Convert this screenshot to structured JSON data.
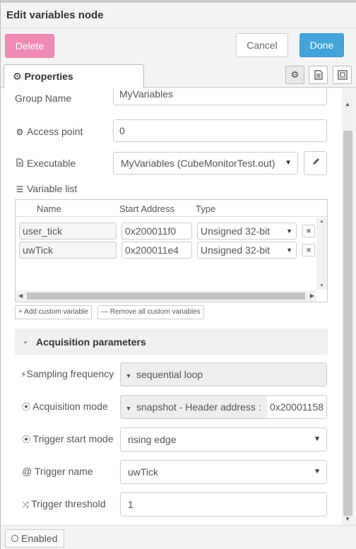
{
  "header": {
    "title": "Edit variables node"
  },
  "toolbar": {
    "delete_label": "Delete",
    "cancel_label": "Cancel",
    "done_label": "Done"
  },
  "tabs": {
    "properties_label": "Properties"
  },
  "form": {
    "group_name_label": "Group Name",
    "group_name_value": "MyVariables",
    "access_point_label": "Access point",
    "access_point_value": "0",
    "executable_label": "Executable",
    "executable_value": "MyVariables (CubeMonitorTest.out)",
    "variable_list_label": "Variable list"
  },
  "variables": {
    "columns": {
      "name": "Name",
      "start_address": "Start Address",
      "type": "Type"
    },
    "rows": [
      {
        "name": "user_tick",
        "address": "0x200011f0",
        "type": "Unsigned 32-bit"
      },
      {
        "name": "uwTick",
        "address": "0x200011e4",
        "type": "Unsigned 32-bit"
      }
    ],
    "add_custom_label": "+ Add custom variable",
    "remove_all_label": "— Remove all custom variables"
  },
  "acquisition": {
    "section_label": "Acquisition parameters",
    "sampling_label": "Sampling frequency",
    "sampling_value": "sequential loop",
    "mode_label": "Acquisition mode",
    "mode_value": "snapshot - Header address :",
    "mode_address": "0x20001158",
    "trigger_start_label": "Trigger start mode",
    "trigger_start_value": "rising edge",
    "trigger_name_label": "@ Trigger name",
    "trigger_name_value": "uwTick",
    "trigger_threshold_label": "Trigger threshold",
    "trigger_threshold_value": "1"
  },
  "footer": {
    "enabled_label": "Enabled"
  },
  "colors": {
    "delete": "#f08bb5",
    "done": "#42a4d9"
  }
}
